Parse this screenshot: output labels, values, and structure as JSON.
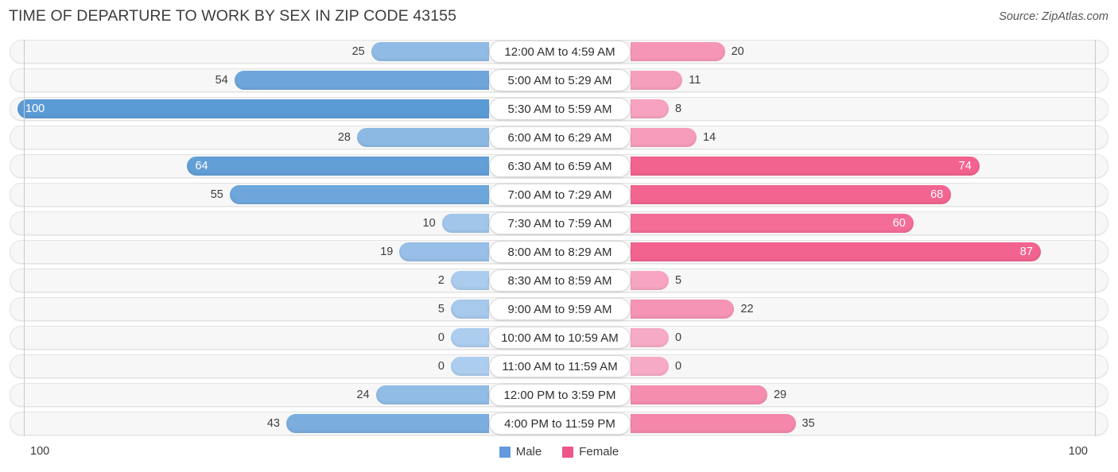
{
  "header": {
    "title": "TIME OF DEPARTURE TO WORK BY SEX IN ZIP CODE 43155",
    "source": "Source: ZipAtlas.com"
  },
  "footer": {
    "axis_left": "100",
    "axis_right": "100",
    "legend": [
      {
        "label": "Male",
        "color": "#6699dd"
      },
      {
        "label": "Female",
        "color": "#ee5588"
      }
    ]
  },
  "chart_data": {
    "type": "bar",
    "title": "TIME OF DEPARTURE TO WORK BY SEX IN ZIP CODE 43155",
    "subtitle": "",
    "xlabel": "",
    "ylabel": "",
    "orientation": "horizontal",
    "layout": "diverging-centered",
    "grid": true,
    "legend_position": "bottom-center",
    "xlim": [
      0,
      100
    ],
    "axis_ticks": [
      "100",
      "100"
    ],
    "categories": [
      "12:00 AM to 4:59 AM",
      "5:00 AM to 5:29 AM",
      "5:30 AM to 5:59 AM",
      "6:00 AM to 6:29 AM",
      "6:30 AM to 6:59 AM",
      "7:00 AM to 7:29 AM",
      "7:30 AM to 7:59 AM",
      "8:00 AM to 8:29 AM",
      "8:30 AM to 8:59 AM",
      "9:00 AM to 9:59 AM",
      "10:00 AM to 10:59 AM",
      "11:00 AM to 11:59 AM",
      "12:00 PM to 3:59 PM",
      "4:00 PM to 11:59 PM"
    ],
    "series": [
      {
        "name": "Male",
        "color": "#6699dd",
        "values": [
          25,
          54,
          100,
          28,
          64,
          55,
          10,
          19,
          2,
          5,
          0,
          0,
          24,
          43
        ]
      },
      {
        "name": "Female",
        "color": "#ee5588",
        "values": [
          20,
          11,
          8,
          14,
          74,
          68,
          60,
          87,
          5,
          22,
          0,
          0,
          29,
          35
        ]
      }
    ]
  },
  "rows": [
    {
      "category": "12:00 AM to 4:59 AM",
      "male": 25,
      "female": 20,
      "male_text": "25",
      "female_text": "20"
    },
    {
      "category": "5:00 AM to 5:29 AM",
      "male": 54,
      "female": 11,
      "male_text": "54",
      "female_text": "11"
    },
    {
      "category": "5:30 AM to 5:59 AM",
      "male": 100,
      "female": 8,
      "male_text": "100",
      "female_text": "8"
    },
    {
      "category": "6:00 AM to 6:29 AM",
      "male": 28,
      "female": 14,
      "male_text": "28",
      "female_text": "14"
    },
    {
      "category": "6:30 AM to 6:59 AM",
      "male": 64,
      "female": 74,
      "male_text": "64",
      "female_text": "74"
    },
    {
      "category": "7:00 AM to 7:29 AM",
      "male": 55,
      "female": 68,
      "male_text": "55",
      "female_text": "68"
    },
    {
      "category": "7:30 AM to 7:59 AM",
      "male": 10,
      "female": 60,
      "male_text": "10",
      "female_text": "60"
    },
    {
      "category": "8:00 AM to 8:29 AM",
      "male": 19,
      "female": 87,
      "male_text": "19",
      "female_text": "87"
    },
    {
      "category": "8:30 AM to 8:59 AM",
      "male": 2,
      "female": 5,
      "male_text": "2",
      "female_text": "5"
    },
    {
      "category": "9:00 AM to 9:59 AM",
      "male": 5,
      "female": 22,
      "male_text": "5",
      "female_text": "22"
    },
    {
      "category": "10:00 AM to 10:59 AM",
      "male": 0,
      "female": 0,
      "male_text": "0",
      "female_text": "0"
    },
    {
      "category": "11:00 AM to 11:59 AM",
      "male": 0,
      "female": 0,
      "male_text": "0",
      "female_text": "0"
    },
    {
      "category": "12:00 PM to 3:59 PM",
      "male": 24,
      "female": 29,
      "male_text": "24",
      "female_text": "29"
    },
    {
      "category": "4:00 PM to 11:59 PM",
      "male": 43,
      "female": 35,
      "male_text": "43",
      "female_text": "35"
    }
  ]
}
